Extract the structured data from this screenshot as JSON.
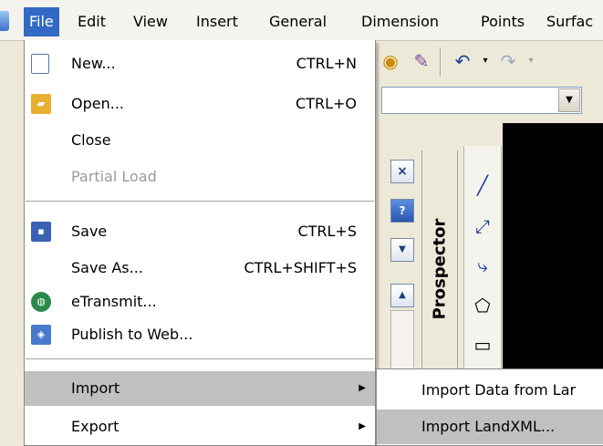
{
  "menubar": {
    "items": [
      "File",
      "Edit",
      "View",
      "Insert",
      "General",
      "Dimension",
      "Points",
      "Surfac"
    ]
  },
  "file_menu": {
    "items": [
      {
        "label": "New...",
        "shortcut": "CTRL+N",
        "icon": "new-document-icon"
      },
      {
        "label": "Open...",
        "shortcut": "CTRL+O",
        "icon": "open-folder-icon"
      },
      {
        "label": "Close"
      },
      {
        "label": "Partial Load",
        "disabled": true
      },
      {
        "label": "Save",
        "shortcut": "CTRL+S",
        "icon": "floppy-disk-icon"
      },
      {
        "label": "Save As...",
        "shortcut": "CTRL+SHIFT+S"
      },
      {
        "label": "eTransmit...",
        "icon": "etransmit-icon"
      },
      {
        "label": "Publish to Web...",
        "icon": "publish-web-icon"
      },
      {
        "label": "Import",
        "submenu": true,
        "highlighted": true
      },
      {
        "label": "Export",
        "submenu": true
      }
    ]
  },
  "import_submenu": {
    "items": [
      {
        "label": "Import Data from Lar"
      },
      {
        "label": "Import LandXML...",
        "highlighted": true
      }
    ]
  },
  "prospector": {
    "title": "Prospector"
  },
  "colors": {
    "menu_highlight": "#316ac5",
    "item_hover": "#c0c0c0",
    "canvas": "#000000",
    "chrome": "#ece9d8"
  }
}
